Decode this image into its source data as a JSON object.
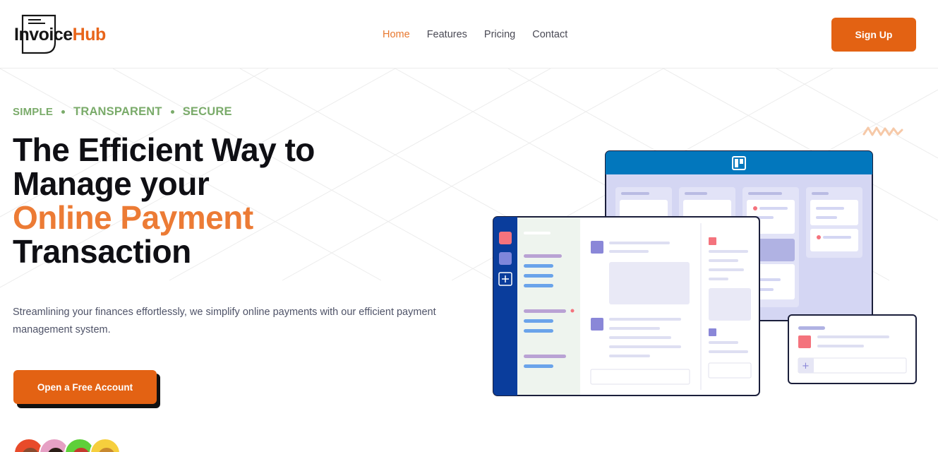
{
  "brand": {
    "name_part1": "Invoice",
    "name_part2": "Hub"
  },
  "nav": {
    "items": [
      {
        "label": "Home",
        "active": true
      },
      {
        "label": "Features",
        "active": false
      },
      {
        "label": "Pricing",
        "active": false
      },
      {
        "label": "Contact",
        "active": false
      }
    ]
  },
  "header": {
    "signup_label": "Sign Up"
  },
  "hero": {
    "tagline": [
      "SIMPLE",
      "TRANSPARENT",
      "SECURE"
    ],
    "headline_line1": "The Efficient Way to",
    "headline_line2": "Manage your",
    "headline_accent": "Online Payment",
    "headline_line4": "Transaction",
    "description": "Streamlining your finances effortlessly, we simplify online payments with our efficient payment management system.",
    "cta_label": "Open a Free Account"
  },
  "colors": {
    "accent": "#e36213",
    "accent_text": "#ec7b35",
    "tagline": "#7aab6a",
    "board_blue": "#0277bd",
    "sidebar_blue": "#0a3d9c"
  },
  "icons": {
    "board": "kanban-board-icon",
    "add": "plus-icon"
  }
}
